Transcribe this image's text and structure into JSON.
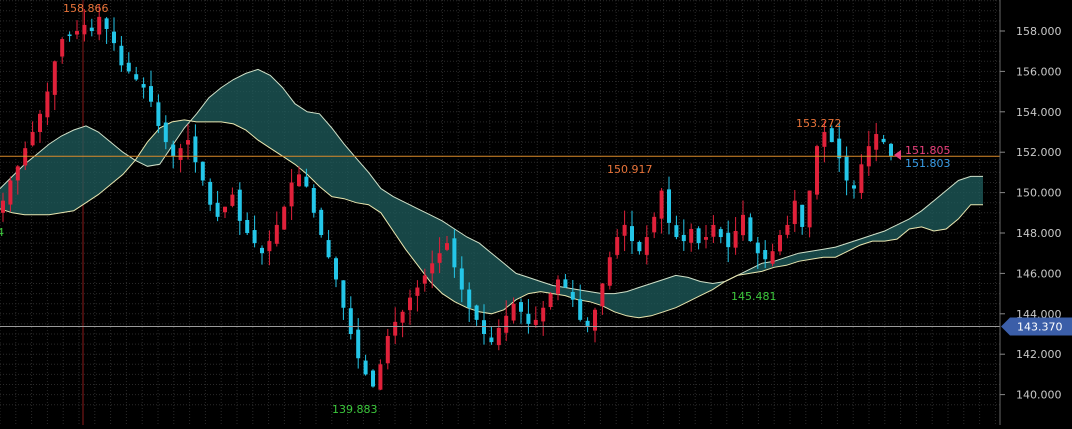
{
  "chart_data": {
    "type": "candlestick",
    "ylim": [
      139.0,
      159.5
    ],
    "y_ticks": [
      "140.000",
      "142.000",
      "144.000",
      "146.000",
      "148.000",
      "150.000",
      "152.000",
      "154.000",
      "156.000",
      "158.000"
    ],
    "grid": true,
    "current_price_marker": {
      "value": 143.37,
      "label": "143.370"
    },
    "last_bid_label": "151.805",
    "last_ask_label": "151.803",
    "reference_line_value": 151.8,
    "annotations": [
      {
        "label": "158.866",
        "value": 158.866,
        "kind": "high"
      },
      {
        "label": "139.883",
        "value": 139.883,
        "kind": "low"
      },
      {
        "label": "150.917",
        "value": 150.917,
        "kind": "high"
      },
      {
        "label": "145.481",
        "value": 145.481,
        "kind": "low"
      },
      {
        "label": "153.272",
        "value": 153.272,
        "kind": "high"
      }
    ],
    "partial_left_label": "4",
    "candles_close": [
      149.6,
      150.6,
      151.3,
      152.2,
      153.0,
      153.9,
      155.0,
      156.5,
      157.6,
      157.8,
      158.0,
      158.3,
      158.0,
      158.7,
      158.1,
      157.4,
      156.3,
      156.0,
      155.6,
      155.2,
      154.5,
      153.3,
      152.5,
      151.8,
      152.2,
      152.6,
      151.5,
      150.6,
      149.4,
      148.8,
      149.3,
      149.9,
      148.6,
      148.0,
      147.5,
      147.0,
      147.6,
      148.4,
      149.3,
      150.5,
      150.9,
      150.3,
      149.0,
      147.9,
      146.8,
      145.7,
      144.3,
      143.0,
      141.8,
      141.0,
      140.4,
      141.5,
      142.9,
      143.6,
      144.1,
      144.8,
      145.3,
      145.9,
      146.5,
      147.0,
      147.5,
      146.3,
      145.2,
      144.3,
      143.7,
      143.0,
      142.6,
      143.3,
      143.9,
      144.5,
      144.1,
      143.5,
      143.7,
      144.3,
      145.0,
      145.7,
      145.3,
      144.7,
      143.7,
      143.4,
      144.2,
      145.5,
      146.8,
      147.8,
      148.4,
      147.6,
      147.1,
      147.8,
      148.8,
      150.1,
      148.5,
      147.8,
      147.6,
      148.2,
      147.5,
      147.8,
      148.4,
      147.8,
      147.3,
      148.1,
      148.9,
      147.6,
      147.0,
      146.7,
      147.1,
      147.9,
      148.4,
      149.6,
      148.3,
      150.1,
      152.3,
      153.0,
      152.5,
      151.7,
      150.6,
      150.2,
      151.4,
      152.3,
      152.9,
      152.5,
      151.8
    ],
    "cloud_top": [
      150.2,
      150.8,
      151.4,
      151.9,
      152.4,
      152.8,
      153.1,
      153.3,
      153.0,
      152.5,
      152.0,
      151.6,
      151.3,
      151.4,
      152.3,
      153.2,
      153.9,
      154.7,
      155.2,
      155.6,
      155.9,
      156.1,
      155.8,
      155.2,
      154.4,
      154.0,
      153.9,
      153.2,
      152.4,
      151.7,
      151.0,
      150.2,
      149.8,
      149.5,
      149.2,
      148.9,
      148.6,
      148.2,
      147.8,
      147.5,
      147.0,
      146.5,
      146.0,
      145.8,
      145.6,
      145.4,
      145.3,
      145.2,
      145.1,
      145.0,
      145.0,
      145.1,
      145.3,
      145.5,
      145.7,
      145.9,
      145.8,
      145.6,
      145.5,
      145.6,
      145.9,
      146.2,
      146.5,
      146.6,
      146.8,
      147.0,
      147.1,
      147.2,
      147.3,
      147.5,
      147.7,
      147.9,
      148.1,
      148.4,
      148.7,
      149.1,
      149.6,
      150.1,
      150.6,
      150.8,
      150.8
    ],
    "cloud_bottom": [
      149.2,
      149.0,
      148.9,
      148.9,
      148.9,
      149.0,
      149.1,
      149.5,
      149.9,
      150.4,
      150.9,
      151.6,
      152.5,
      153.2,
      153.5,
      153.6,
      153.5,
      153.5,
      153.5,
      153.4,
      153.1,
      152.6,
      152.2,
      151.8,
      151.4,
      150.9,
      150.3,
      149.8,
      149.7,
      149.5,
      149.4,
      149.0,
      148.1,
      147.2,
      146.4,
      145.6,
      145.0,
      144.6,
      144.3,
      144.1,
      144.0,
      144.2,
      144.7,
      145.0,
      145.1,
      145.0,
      144.9,
      144.7,
      144.6,
      144.4,
      144.1,
      143.9,
      143.8,
      143.9,
      144.1,
      144.3,
      144.6,
      144.9,
      145.2,
      145.6,
      145.9,
      146.0,
      146.1,
      146.3,
      146.4,
      146.6,
      146.7,
      146.8,
      146.8,
      147.1,
      147.4,
      147.6,
      147.6,
      147.7,
      148.2,
      148.3,
      148.1,
      148.2,
      148.7,
      149.4,
      149.4
    ]
  }
}
